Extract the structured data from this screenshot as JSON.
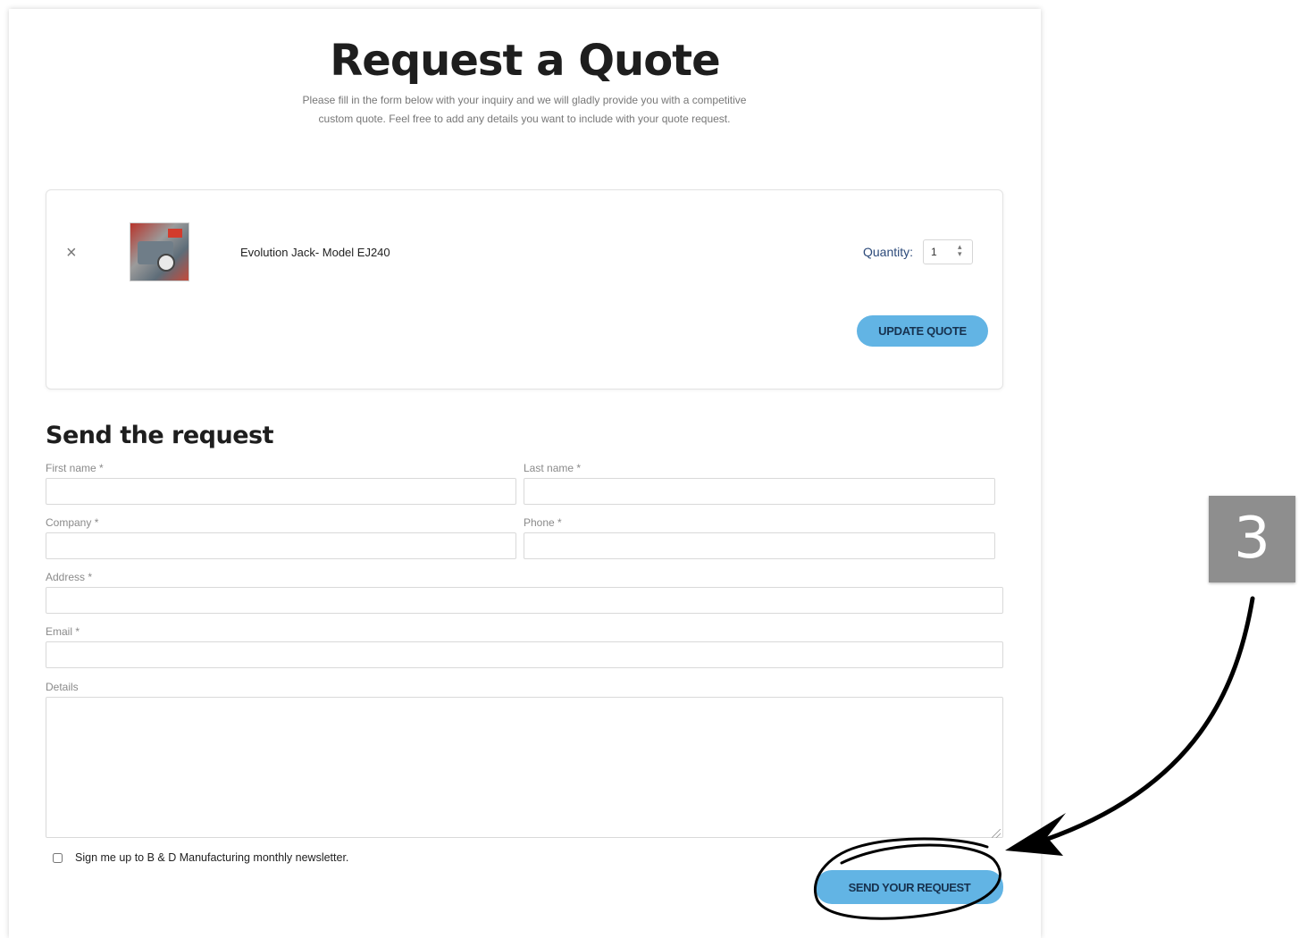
{
  "header": {
    "title": "Request a Quote",
    "intro": "Please fill in the form below with your inquiry and we will gladly provide you with a competitive custom quote. Feel free to add any details you want to include with your quote request."
  },
  "cart": {
    "remove_icon": "×",
    "product_name": "Evolution Jack- Model EJ240",
    "quantity_label": "Quantity:",
    "quantity_value": "1",
    "update_button": "UPDATE QUOTE"
  },
  "form": {
    "heading": "Send the request",
    "first_name_label": "First name *",
    "last_name_label": "Last name *",
    "company_label": "Company *",
    "phone_label": "Phone *",
    "address_label": "Address *",
    "email_label": "Email *",
    "details_label": "Details",
    "newsletter_label": "Sign me up to B & D Manufacturing monthly newsletter.",
    "submit_button": "SEND YOUR REQUEST"
  },
  "annotation": {
    "step_number": "3",
    "arrow_icon": "curved-arrow-icon",
    "circle_icon": "hand-drawn-circle-icon"
  },
  "colors": {
    "button": "#62b4e4",
    "button_text": "#17324f",
    "badge": "#8e8e8e"
  }
}
